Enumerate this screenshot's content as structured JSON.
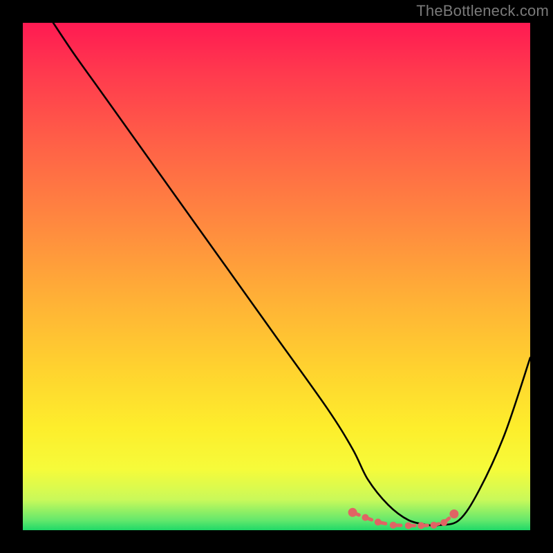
{
  "watermark": "TheBottleneck.com",
  "chart_data": {
    "type": "line",
    "title": "",
    "xlabel": "",
    "ylabel": "",
    "xlim": [
      0,
      100
    ],
    "ylim": [
      0,
      100
    ],
    "grid": false,
    "series": [
      {
        "name": "bottleneck-curve",
        "x": [
          6,
          10,
          15,
          20,
          30,
          40,
          50,
          60,
          65,
          68,
          72,
          76,
          80,
          82,
          86,
          90,
          95,
          100
        ],
        "y": [
          100,
          94,
          87,
          80,
          66,
          52,
          38,
          24,
          16,
          10,
          5,
          2,
          1,
          1,
          2,
          8,
          19,
          34
        ],
        "color": "#000000"
      }
    ],
    "markers": {
      "name": "optimal-range",
      "color": "#e06464",
      "points_x": [
        65,
        67.5,
        70,
        73,
        76,
        78.5,
        81,
        83,
        85
      ],
      "points_y": [
        3.5,
        2.5,
        1.6,
        1.0,
        0.9,
        0.9,
        1.0,
        1.5,
        3.2
      ]
    },
    "gradient_stops": [
      {
        "pos": 0,
        "color": "#ff1a52"
      },
      {
        "pos": 40,
        "color": "#ff8a3f"
      },
      {
        "pos": 80,
        "color": "#fdee2c"
      },
      {
        "pos": 100,
        "color": "#1fd968"
      }
    ]
  }
}
